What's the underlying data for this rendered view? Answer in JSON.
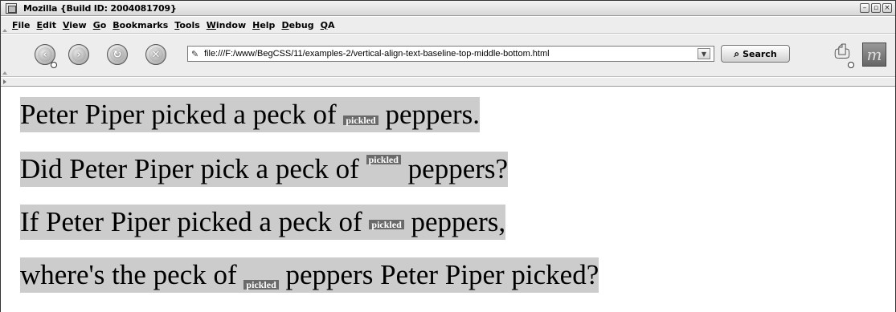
{
  "window": {
    "title": "Mozilla {Build ID: 2004081709}",
    "controls": [
      "–",
      "▫",
      "×"
    ]
  },
  "menu": {
    "items": [
      "File",
      "Edit",
      "View",
      "Go",
      "Bookmarks",
      "Tools",
      "Window",
      "Help",
      "Debug",
      "QA"
    ]
  },
  "navigation": {
    "url": "file:///F:/www/BegCSS/11/examples-2/vertical-align-text-baseline-top-middle-bottom.html",
    "search_label": "Search",
    "throbber_letter": "m"
  },
  "content": {
    "lines": [
      {
        "before": "Peter Piper picked a peck of ",
        "badge": "pickled",
        "after": " peppers.",
        "badge_align": "baseline"
      },
      {
        "before": "Did Peter Piper pick a peck of ",
        "badge": "pickled",
        "after": " peppers?",
        "badge_align": "top"
      },
      {
        "before": "If Peter Piper picked a peck of ",
        "badge": "pickled",
        "after": " peppers,",
        "badge_align": "middle"
      },
      {
        "before": "where's the peck of ",
        "badge": "pickled",
        "after": " peppers Peter Piper picked?",
        "badge_align": "bottom"
      }
    ],
    "line_background": "#cccccc",
    "badge_background": "#6a6a6a"
  }
}
